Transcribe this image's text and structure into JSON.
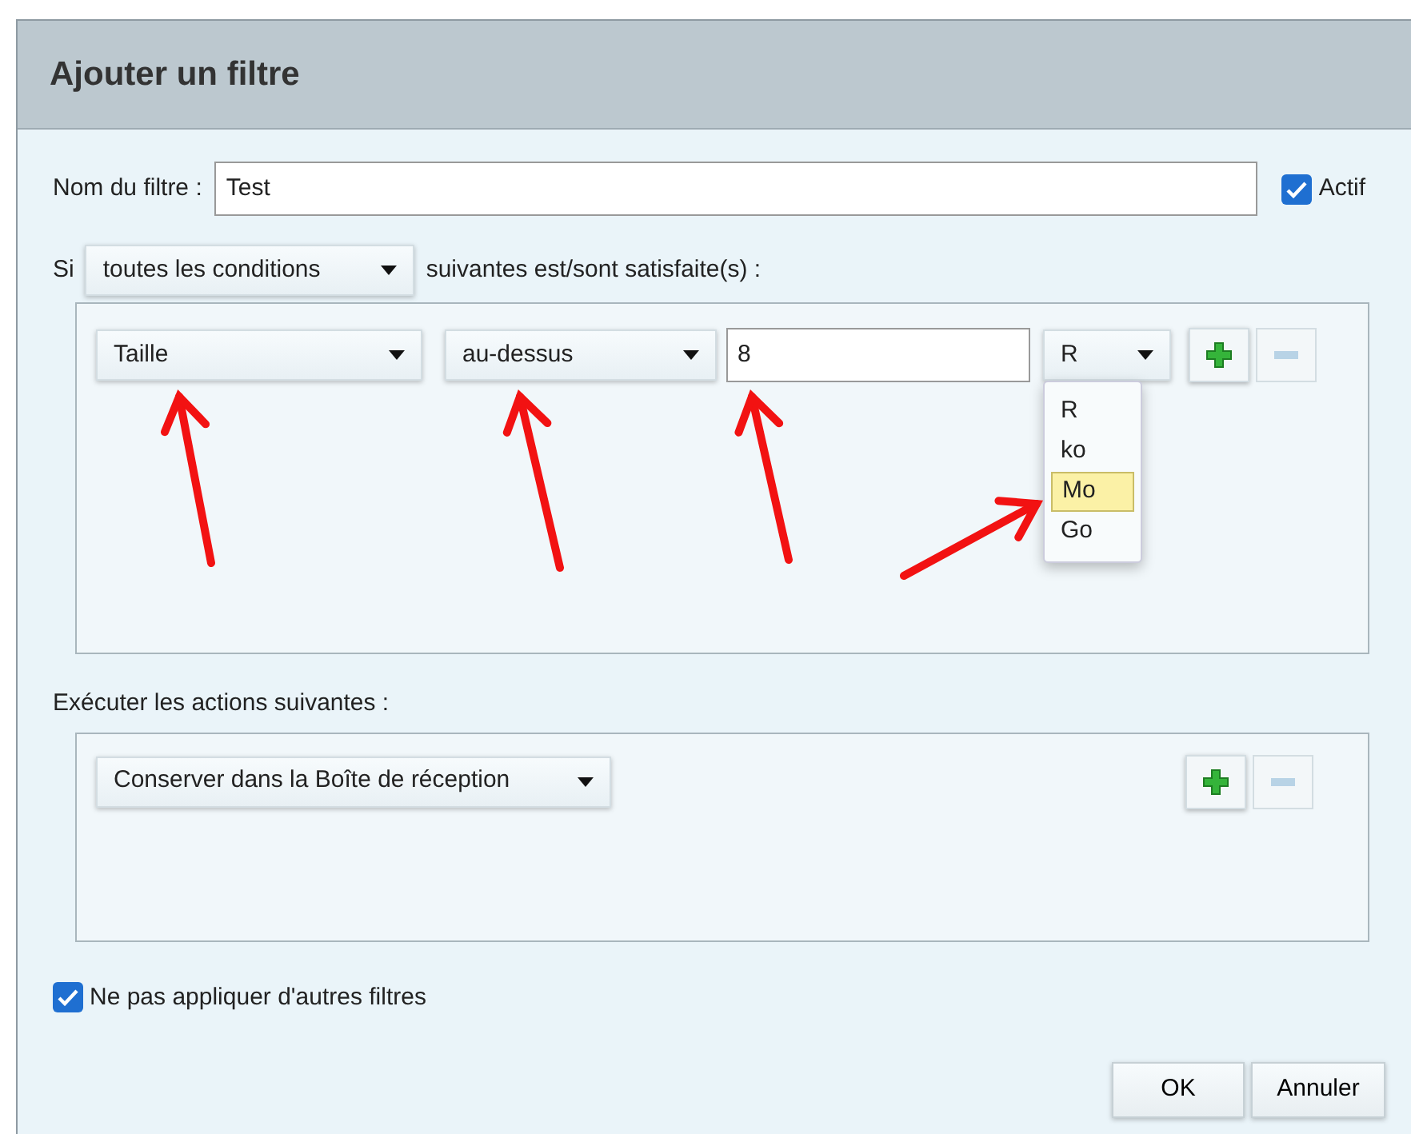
{
  "window": {
    "title": "Ajouter un filtre"
  },
  "name_field": {
    "label": "Nom du filtre :",
    "value": "Test"
  },
  "active": {
    "label": "Actif",
    "checked": true
  },
  "match": {
    "prefix": "Si",
    "value": "toutes les conditions",
    "suffix": "suivantes est/sont satisfaite(s) :"
  },
  "conditions": [
    {
      "field": "Taille",
      "operator": "au-dessus",
      "value": "8",
      "unit": "R",
      "unit_menu": {
        "open": true,
        "options": [
          {
            "label": "R",
            "selected": false
          },
          {
            "label": "ko",
            "selected": false
          },
          {
            "label": "Mo",
            "selected": true
          },
          {
            "label": "Go",
            "selected": false
          }
        ]
      }
    }
  ],
  "condition_buttons": [
    {
      "kind": "add",
      "disabled": false
    },
    {
      "kind": "remove",
      "disabled": true
    }
  ],
  "actions_label": "Exécuter les actions suivantes :",
  "actions": [
    {
      "value": "Conserver dans la Boîte de réception"
    }
  ],
  "action_buttons": [
    {
      "kind": "add",
      "disabled": false
    },
    {
      "kind": "remove",
      "disabled": true
    }
  ],
  "stop_other": {
    "label": "Ne pas appliquer d'autres filtres",
    "checked": true
  },
  "buttons": [
    {
      "label": "OK"
    },
    {
      "label": "Annuler"
    }
  ],
  "annotations": [
    {
      "kind": "arrow"
    },
    {
      "kind": "arrow"
    },
    {
      "kind": "arrow"
    },
    {
      "kind": "arrow"
    }
  ]
}
